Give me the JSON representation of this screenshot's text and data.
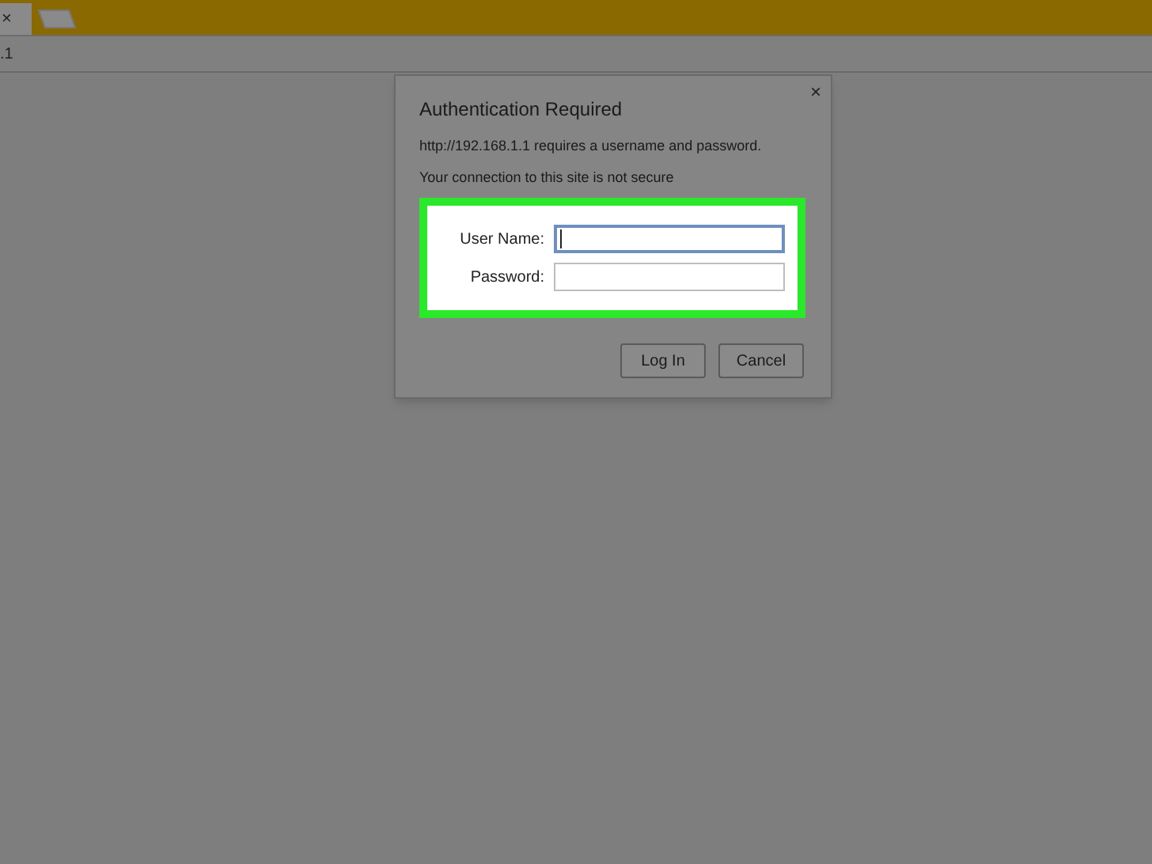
{
  "browser": {
    "tab_close": "×",
    "address": ".1"
  },
  "dialog": {
    "title": "Authentication Required",
    "close": "×",
    "message": "http://192.168.1.1 requires a username and password.",
    "warning": "Your connection to this site is not secure",
    "fields": [
      {
        "label": "User Name:",
        "focused": true
      },
      {
        "label": "Password:",
        "focused": false
      }
    ],
    "buttons": [
      "Log In",
      "Cancel"
    ]
  }
}
